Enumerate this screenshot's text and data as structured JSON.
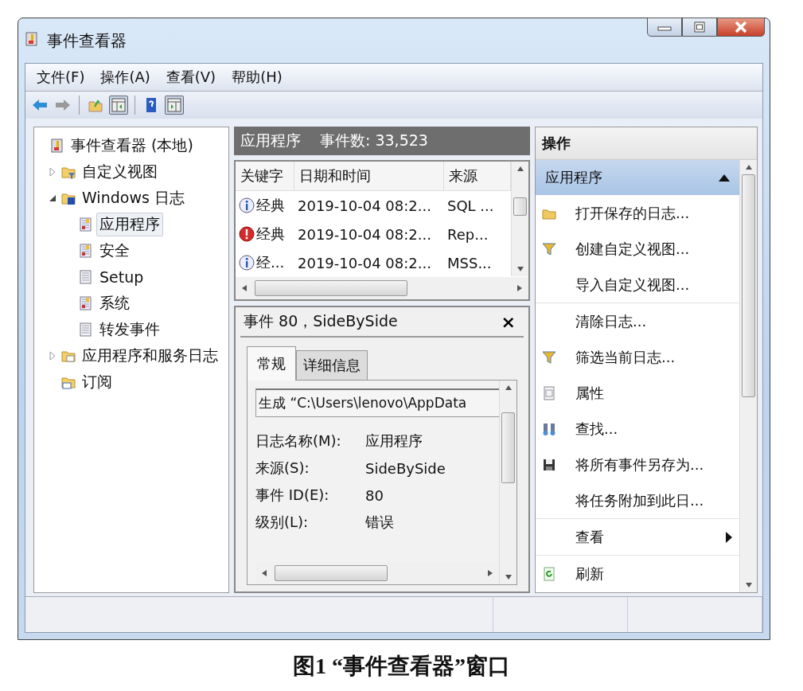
{
  "window": {
    "title": "事件查看器"
  },
  "menu": [
    "文件(F)",
    "操作(A)",
    "查看(V)",
    "帮助(H)"
  ],
  "toolbar": [
    {
      "kind": "back",
      "disabled": false
    },
    {
      "kind": "forward",
      "disabled": true
    },
    {
      "kind": "separator"
    },
    {
      "kind": "folder",
      "disabled": false
    },
    {
      "kind": "pane-left",
      "on": true
    },
    {
      "kind": "separator"
    },
    {
      "kind": "help",
      "disabled": false
    },
    {
      "kind": "pane-right",
      "on": true
    }
  ],
  "tree": [
    {
      "label": "事件查看器 (本地)",
      "kind": "viewer",
      "selected": false,
      "children": [
        {
          "label": "自定义视图",
          "kind": "folder-filter",
          "expanded": false,
          "selected": false
        },
        {
          "label": "Windows 日志",
          "kind": "folder-windows",
          "expanded": true,
          "selected": false,
          "children": [
            {
              "label": "应用程序",
              "kind": "log",
              "selected": true
            },
            {
              "label": "安全",
              "kind": "log",
              "selected": false
            },
            {
              "label": "Setup",
              "kind": "log-plain",
              "selected": false
            },
            {
              "label": "系统",
              "kind": "log",
              "selected": false
            },
            {
              "label": "转发事件",
              "kind": "log-plain",
              "selected": false
            }
          ]
        },
        {
          "label": "应用程序和服务日志",
          "kind": "folder",
          "expanded": false,
          "selected": false
        },
        {
          "label": "订阅",
          "kind": "subscription",
          "selected": false
        }
      ]
    }
  ],
  "log_header": {
    "name": "应用程序",
    "count": "事件数: 33,523"
  },
  "events": {
    "columns": [
      "关键字",
      "日期和时间",
      "来源"
    ],
    "rows": [
      {
        "kind": "info",
        "keyword": "经典",
        "date": "2019-10-04 08:2...",
        "source": "SQL ..."
      },
      {
        "kind": "error",
        "keyword": "经典",
        "date": "2019-10-04 08:2...",
        "source": "Rep..."
      },
      {
        "kind": "info",
        "keyword": "经...",
        "date": "2019-10-04 08:2...",
        "source": "MSS..."
      }
    ]
  },
  "detail": {
    "title": "事件 80，SideBySide",
    "close": "×",
    "tabs": [
      {
        "label": "常规",
        "selected": true
      },
      {
        "label": "详细信息",
        "selected": false
      }
    ],
    "description": "生成 “C:\\Users\\lenovo\\AppData",
    "fields": [
      {
        "label": "日志名称(M):",
        "value": "应用程序"
      },
      {
        "label": "来源(S):",
        "value": "SideBySide"
      },
      {
        "label": "事件 ID(E):",
        "value": "80"
      },
      {
        "label": "级别(L):",
        "value": "错误"
      }
    ]
  },
  "actions": {
    "title": "操作",
    "section": {
      "title": "应用程序",
      "expanded": true
    },
    "groups": [
      [
        {
          "label": "打开保存的日志...",
          "kind": "folder",
          "submenu": false
        },
        {
          "label": "创建自定义视图...",
          "kind": "filter",
          "submenu": false
        },
        {
          "label": "导入自定义视图...",
          "kind": "plain",
          "submenu": false
        }
      ],
      [
        {
          "label": "清除日志...",
          "kind": "plain",
          "submenu": false
        },
        {
          "label": "筛选当前日志...",
          "kind": "filter",
          "submenu": false
        },
        {
          "label": "属性",
          "kind": "properties",
          "submenu": false
        },
        {
          "label": "查找...",
          "kind": "binoculars",
          "submenu": false
        },
        {
          "label": "将所有事件另存为...",
          "kind": "save",
          "submenu": false
        },
        {
          "label": "将任务附加到此日...",
          "kind": "plain",
          "submenu": false
        }
      ],
      [
        {
          "label": "查看",
          "kind": "plain",
          "submenu": true
        }
      ],
      [
        {
          "label": "刷新",
          "kind": "refresh",
          "submenu": false
        }
      ]
    ]
  },
  "caption": "图1 “事件查看器”窗口"
}
